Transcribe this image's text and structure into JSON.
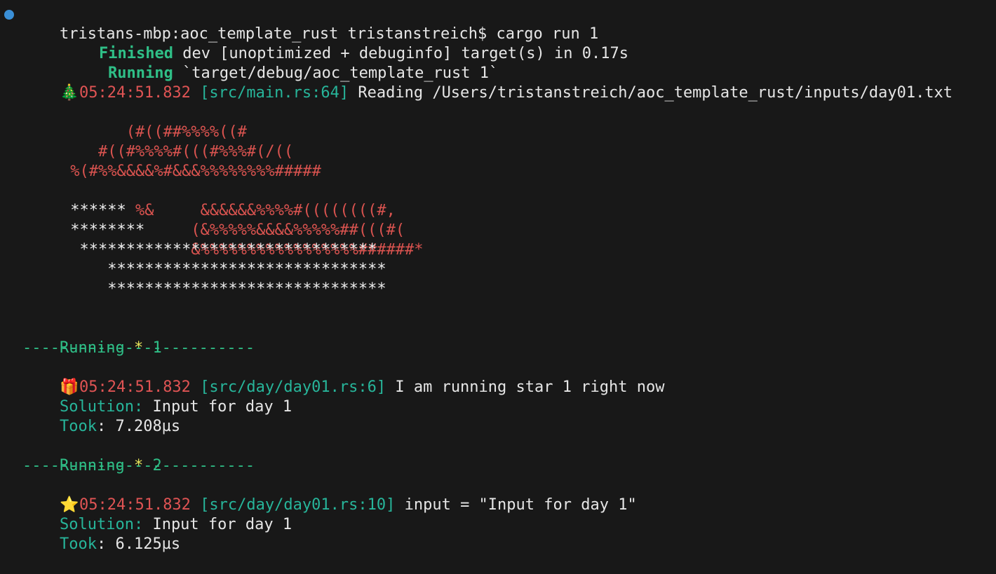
{
  "terminal": {
    "prompt": "tristans-mbp:aoc_template_rust tristanstreich$ cargo run 1",
    "finished_label": "Finished",
    "finished_text": " dev [unoptimized + debuginfo] target(s) in 0.17s",
    "running_label": "Running",
    "running_text": " `target/debug/aoc_template_rust 1`",
    "log1": {
      "emoji": "🎄",
      "time": "05:24:51.832",
      "source": "[src/main.rs:64]",
      "message": "Reading /Users/tristanstreich/aoc_template_rust/inputs/day01.txt"
    },
    "art": {
      "line1": "           (#((##%%%%((#",
      "line2": "        #((#%%%%#(((#%%%#(/((",
      "line3": "     %(#%%&&&&%#&&&%%%%%%%%#####",
      "line4_left": " ****** ",
      "line4_right": "%&     &&&&&&%%%%#((((((((#,",
      "line5_left": " ********",
      "line5_right": "     (&%%%%%&&&&%%%%%##(((#(",
      "line6_left": "  *****",
      "line6_right": "       &%%%%%%%%%%%%%%%%%######*",
      "line7": "          ****************************",
      "line8": "         ******************************",
      "line9": "         ******************************"
    },
    "star1": {
      "running_label": "Running",
      "star_symbol": "*",
      "number": "1",
      "separator": "-------------------------",
      "emoji": "🎁",
      "time": "05:24:51.832",
      "source": "[src/day/day01.rs:6]",
      "message": "I am running star 1 right now",
      "solution_label": "Solution:",
      "solution_value": " Input for day 1",
      "took_label": "Took",
      "took_value": ": 7.208µs"
    },
    "star2": {
      "running_label": "Running",
      "star_symbol": "*",
      "number": "2",
      "separator": "-------------------------",
      "emoji": "⭐",
      "time": "05:24:51.832",
      "source": "[src/day/day01.rs:10]",
      "message": "input = \"Input for day 1\"",
      "solution_label": "Solution:",
      "solution_value": " Input for day 1",
      "took_label": "Took",
      "took_value": ": 6.125µs"
    },
    "colors": {
      "background": "#181818",
      "green": "#2fbf87",
      "red": "#e05454",
      "teal": "#27b59a",
      "yellow": "#e7e35a",
      "prompt_dot": "#3a8fd6"
    }
  }
}
